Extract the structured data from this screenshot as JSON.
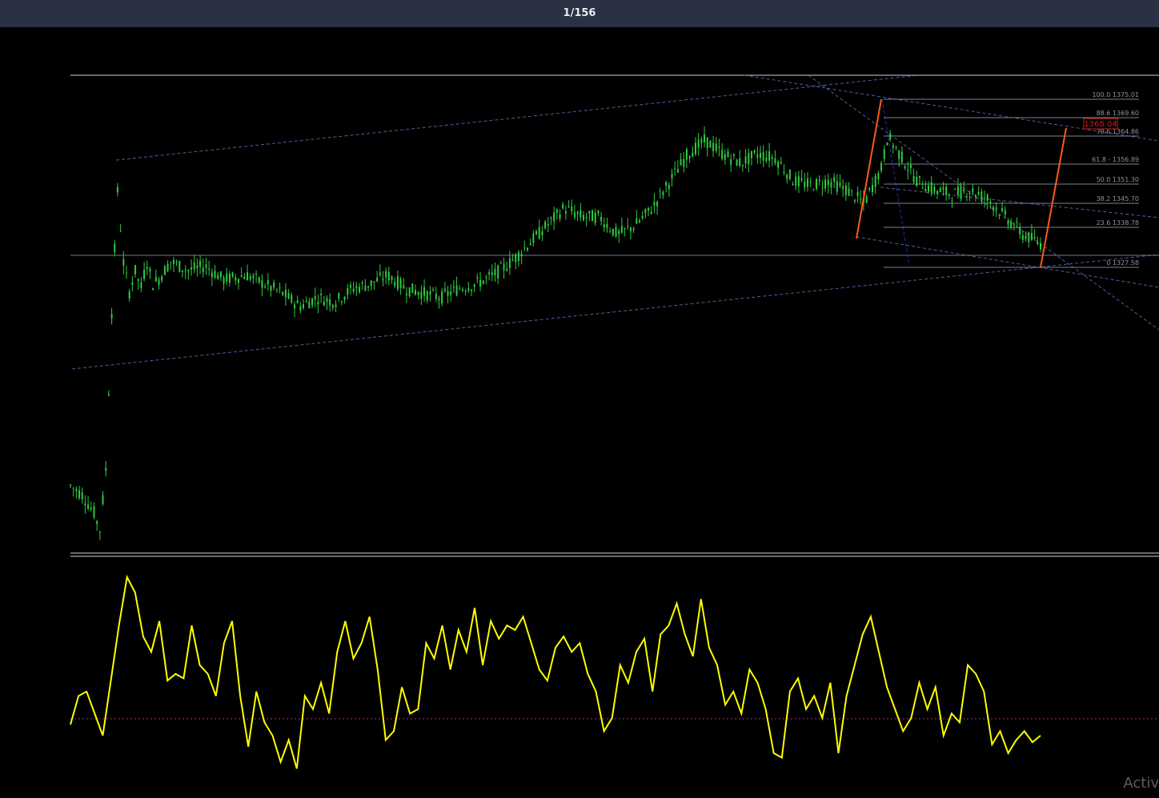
{
  "toolbar": {
    "counter": "1/156"
  },
  "watermark": "Activ",
  "colors": {
    "background": "#000000",
    "header": "#2a3142",
    "candle": "#2ecc40",
    "oscillator": "#ffff00",
    "fib_line": "#7a8590",
    "channel": "#6a7fd0",
    "zigzag": "#ff5a1a",
    "price_box": "#d01a1a"
  },
  "chart_data": [
    {
      "type": "candlestick",
      "description": "price panel",
      "channel_lines": 3,
      "price_marker": "1368.04",
      "fib_levels": [
        {
          "label": "100.0 1375.01"
        },
        {
          "label": "88.6 1369.60"
        },
        {
          "label": "78.6 1364.86"
        },
        {
          "label": "61.8 - 1356.89"
        },
        {
          "label": "50.0 1351.30"
        },
        {
          "label": "38.2 1345.70"
        },
        {
          "label": "23.6 1338.78"
        },
        {
          "label": "0 1327.58"
        }
      ],
      "price_path": [
        [
          0,
          0.12
        ],
        [
          2,
          0.1
        ],
        [
          4,
          0.06
        ],
        [
          5,
          0.02
        ],
        [
          6,
          0.15
        ],
        [
          7,
          0.5
        ],
        [
          8,
          0.78
        ],
        [
          9,
          0.62
        ],
        [
          10,
          0.55
        ],
        [
          11,
          0.6
        ],
        [
          12,
          0.56
        ],
        [
          13,
          0.62
        ],
        [
          14,
          0.57
        ],
        [
          15,
          0.58
        ],
        [
          17,
          0.62
        ],
        [
          20,
          0.6
        ],
        [
          23,
          0.61
        ],
        [
          26,
          0.58
        ],
        [
          30,
          0.59
        ],
        [
          33,
          0.57
        ],
        [
          36,
          0.55
        ],
        [
          39,
          0.52
        ],
        [
          42,
          0.54
        ],
        [
          45,
          0.53
        ],
        [
          48,
          0.56
        ],
        [
          51,
          0.57
        ],
        [
          54,
          0.59
        ],
        [
          57,
          0.56
        ],
        [
          60,
          0.55
        ],
        [
          63,
          0.54
        ],
        [
          66,
          0.56
        ],
        [
          69,
          0.57
        ],
        [
          72,
          0.59
        ],
        [
          75,
          0.62
        ],
        [
          78,
          0.66
        ],
        [
          81,
          0.7
        ],
        [
          84,
          0.74
        ],
        [
          87,
          0.72
        ],
        [
          90,
          0.72
        ],
        [
          93,
          0.68
        ],
        [
          96,
          0.7
        ],
        [
          99,
          0.74
        ],
        [
          102,
          0.8
        ],
        [
          105,
          0.86
        ],
        [
          108,
          0.89
        ],
        [
          111,
          0.86
        ],
        [
          114,
          0.84
        ],
        [
          117,
          0.86
        ],
        [
          120,
          0.85
        ],
        [
          123,
          0.8
        ],
        [
          126,
          0.79
        ],
        [
          129,
          0.8
        ],
        [
          132,
          0.78
        ],
        [
          135,
          0.75
        ],
        [
          138,
          0.83
        ],
        [
          139,
          0.9
        ],
        [
          141,
          0.86
        ],
        [
          144,
          0.8
        ],
        [
          147,
          0.78
        ],
        [
          150,
          0.77
        ],
        [
          153,
          0.78
        ],
        [
          156,
          0.76
        ],
        [
          159,
          0.72
        ],
        [
          162,
          0.68
        ],
        [
          165,
          0.66
        ]
      ]
    },
    {
      "type": "line",
      "description": "oscillator panel",
      "values": [
        0.25,
        0.38,
        0.4,
        0.3,
        0.2,
        0.45,
        0.7,
        0.92,
        0.85,
        0.65,
        0.58,
        0.72,
        0.45,
        0.48,
        0.46,
        0.7,
        0.52,
        0.48,
        0.38,
        0.62,
        0.72,
        0.38,
        0.15,
        0.4,
        0.26,
        0.2,
        0.08,
        0.18,
        0.05,
        0.38,
        0.32,
        0.44,
        0.3,
        0.58,
        0.72,
        0.55,
        0.62,
        0.74,
        0.5,
        0.18,
        0.22,
        0.42,
        0.3,
        0.32,
        0.62,
        0.55,
        0.7,
        0.5,
        0.68,
        0.58,
        0.78,
        0.52,
        0.72,
        0.64,
        0.7,
        0.68,
        0.74,
        0.62,
        0.5,
        0.45,
        0.6,
        0.65,
        0.58,
        0.62,
        0.48,
        0.4,
        0.22,
        0.28,
        0.52,
        0.44,
        0.58,
        0.64,
        0.4,
        0.66,
        0.7,
        0.8,
        0.66,
        0.56,
        0.82,
        0.6,
        0.52,
        0.34,
        0.4,
        0.3,
        0.5,
        0.44,
        0.32,
        0.12,
        0.1,
        0.4,
        0.46,
        0.32,
        0.38,
        0.28,
        0.44,
        0.12,
        0.38,
        0.52,
        0.66,
        0.74,
        0.58,
        0.42,
        0.32,
        0.22,
        0.28,
        0.44,
        0.32,
        0.42,
        0.2,
        0.3,
        0.26,
        0.52,
        0.48,
        0.4,
        0.16,
        0.22,
        0.12,
        0.18,
        0.22,
        0.17,
        0.2
      ],
      "baseline": 0.25
    }
  ]
}
